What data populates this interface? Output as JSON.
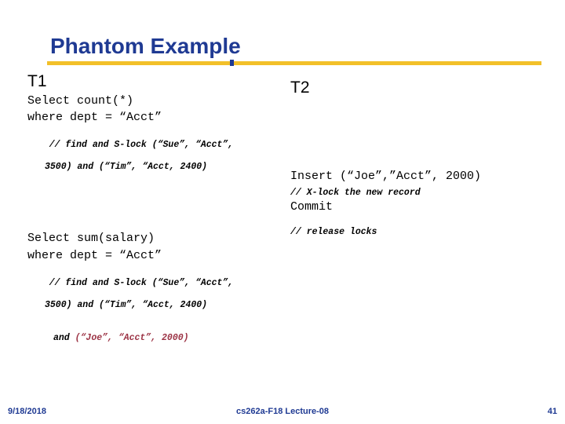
{
  "slide": {
    "title": "Phantom Example",
    "accent_color": "#f2c029",
    "title_color": "#1f3a93",
    "highlight_color": "#9c3345"
  },
  "t1": {
    "label": "T1",
    "stmt1_line1": "Select count(*)",
    "stmt1_line2": "where dept = “Acct”",
    "comment1_line1": "// find and S-lock (“Sue”, “Acct”,",
    "comment1_line2": "3500) and (“Tim”, “Acct, 2400)",
    "stmt2_line1": "Select sum(salary)",
    "stmt2_line2": "where dept = “Acct”",
    "comment2_line1": "// find and S-lock (“Sue”, “Acct”,",
    "comment2_line2": "3500) and (“Tim”, “Acct, 2400)",
    "comment2_line3_plain": "and ",
    "comment2_line3_highlight": "(“Joe”, “Acct”, 2000)"
  },
  "t2": {
    "label": "T2",
    "insert_stmt": "Insert (“Joe”,”Acct”, 2000)",
    "insert_comment": "// X-lock the new record",
    "commit_stmt": "Commit",
    "release_comment": "// release locks"
  },
  "footer": {
    "date": "9/18/2018",
    "course": "cs262a-F18 Lecture-08",
    "page": "41"
  }
}
